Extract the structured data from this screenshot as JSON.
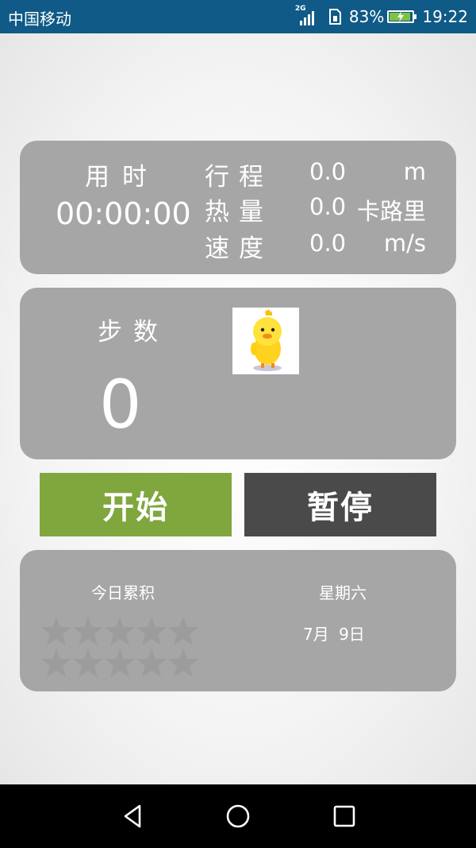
{
  "status_bar": {
    "carrier": "中国移动",
    "network": "2G",
    "battery_percent": "83%",
    "battery_level": 0.83,
    "time": "19:22",
    "accent_color": "#0f5a86"
  },
  "summary": {
    "time_label": "用时",
    "time_value": "00:00:00",
    "distance_label": "行程",
    "distance_value": "0.0",
    "distance_unit": "m",
    "calories_label": "热量",
    "calories_value": "0.0",
    "calories_unit": "卡路里",
    "speed_label": "速度",
    "speed_value": "0.0",
    "speed_unit": "m/s"
  },
  "steps": {
    "label": "步数",
    "value": "0",
    "mascot_icon": "duck-mascot-icon"
  },
  "controls": {
    "start_label": "开始",
    "start_color": "#80a63e",
    "pause_label": "暂停",
    "pause_color": "#4a4a4a"
  },
  "daily": {
    "accumulated_label": "今日累积",
    "stars_filled": 0,
    "stars_total": 10,
    "weekday": "星期六",
    "date": "7月 9日"
  },
  "nav": {
    "back_icon": "back-triangle-icon",
    "home_icon": "home-circle-icon",
    "recent_icon": "recent-square-icon"
  }
}
